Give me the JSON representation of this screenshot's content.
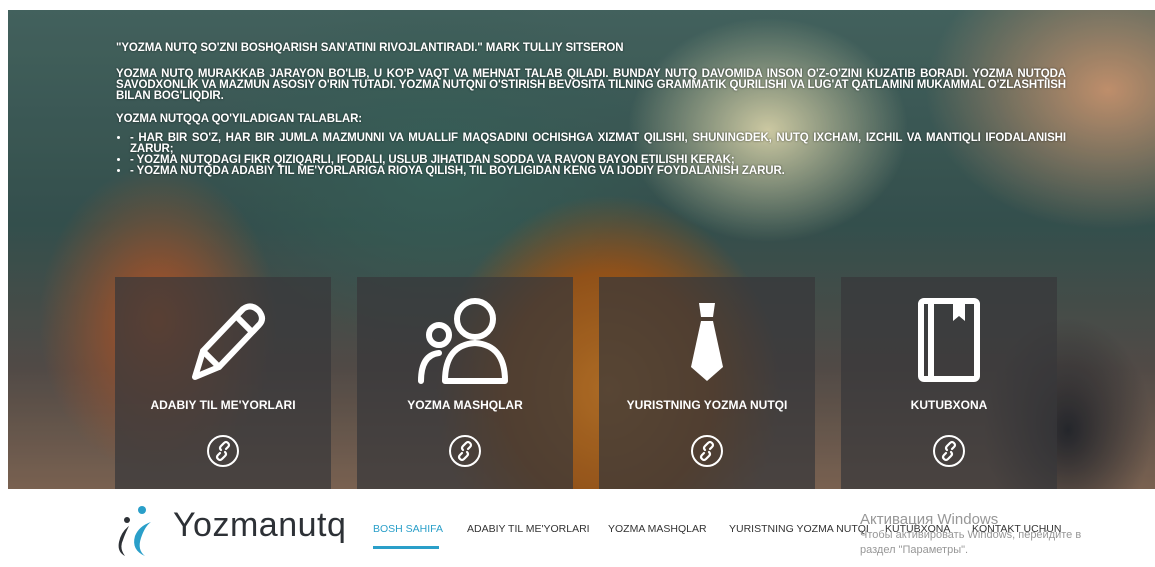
{
  "hero": {
    "quote": "\"YOZMA NUTQ SO'ZNI BOSHQARISH SAN'ATINI RIVOJLANTIRADI.\" MARK TULLIY SITSERON",
    "paragraph": "YOZMA NUTQ MURAKKAB JARAYON BO'LIB, U KO'P VAQT VA MEHNAT TALAB QILADI. BUNDAY NUTQ DAVOMIDA INSON O'Z-O'ZINI KUZATIB BORADI. YOZMA NUTQDA SAVODXONLIK VA MAZMUN ASOSIY O'RIN TUTADI. YOZMA NUTQNI O'STIRISH BEVOSITA TILNING GRAMMATIK QURILISHI VA LUG'AT QATLAMINI MUKAMMAL O'ZLASHTIISH BILAN BOG'LIQDIR.",
    "requirements_heading": "YOZMA NUTQQA QO'YILADIGAN TALABLAR:",
    "requirements": [
      "- HAR BIR SO'Z, HAR BIR JUMLA MAZMUNNI VA MUALLIF MAQSADINI OCHISHGA XIZMAT QILISHI, SHUNINGDEK, NUTQ IXCHAM, IZCHIL VA MANTIQLI IFODALANISHI ZARUR;",
      "- YOZMA NUTQDAGI FIKR QIZIQARLI, IFODALI, USLUB JIHATIDAN SODDA VA RAVON BAYON ETILISHI KERAK;",
      "- YOZMA NUTQDA ADABIY TIL ME'YORLARIGA RIOYA QILISH, TIL BOYLIGIDAN KENG VA IJODIY FOYDALANISH ZARUR."
    ]
  },
  "cards": [
    {
      "title": "ADABIY TIL ME'YORLARI",
      "icon": "pencil-icon"
    },
    {
      "title": "YOZMA MASHQLAR",
      "icon": "users-icon"
    },
    {
      "title": "YURISTNING YOZMA NUTQI",
      "icon": "tie-icon"
    },
    {
      "title": "KUTUBXONA",
      "icon": "book-icon"
    }
  ],
  "footer": {
    "logo_text": "Yozmanutq",
    "nav": [
      "BOSH SAHIFA",
      "ADABIY TIL ME'YORLARI",
      "YOZMA MASHQLAR",
      "YURISTNING YOZMA NUTQI",
      "KUTUBXONA",
      "KONTAKT UCHUN"
    ],
    "active_index": 0
  },
  "os_watermark": {
    "line1": "Активация Windows",
    "line2": "Чтобы активировать Windows, перейдите в",
    "line3": "раздел \"Параметры\"."
  },
  "colors": {
    "accent": "#2a9fc9",
    "card_bg": "rgba(55,55,58,0.72)",
    "text_dark": "#333333"
  }
}
